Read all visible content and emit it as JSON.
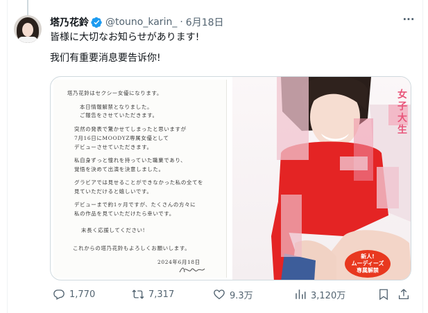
{
  "tweet": {
    "display_name": "塔乃花鈴",
    "handle": "@touno_karin_",
    "separator": "·",
    "date": "6月18日",
    "more_glyph": "···",
    "text_ja": "皆様に大切なお知らせがあります!",
    "text_zh": "我们有重要消息要告诉你!"
  },
  "media": {
    "letter_lines": [
      "塔乃花鈴はセクシー女優になります。",
      "本日情報解禁となりました。",
      "ご報告をさせていただきます。",
      "突然の発表で驚かせてしまったと思いますが",
      "7月16日にMOODYZ専属女優として",
      "デビューさせていただきます。",
      "私自身ずっと憧れを持っていた職業であり、",
      "覚悟を決めて出演を決意しました。",
      "グラビアでは見せることができなかった私の全てを",
      "見ていただけると嬉しいです。",
      "デビューまで約1ヶ月ですが、たくさんの方々に",
      "私の作品を見ていただけたら幸いです。",
      "末長く応援してください!",
      "これからの塔乃花鈴もよろしくお願いします。",
      "2024年6月18日"
    ],
    "photo_vertical_text": "女子大生",
    "badge_line1": "新人!",
    "badge_line2": "ムーディーズ",
    "badge_line3": "専属解禁"
  },
  "actions": {
    "replies": "1,770",
    "reposts": "7,317",
    "likes": "9.3万",
    "views": "3,120万"
  },
  "colors": {
    "verified": "#1d9bf0",
    "text": "#0f1419",
    "muted": "#536471",
    "border": "#cfd9de"
  },
  "icons": {
    "reply": "speech-bubble-icon",
    "repost": "repost-arrows-icon",
    "like": "heart-icon",
    "views": "bar-chart-icon",
    "bookmark": "bookmark-icon",
    "share": "share-icon",
    "verified": "verified-badge-icon",
    "more": "more-dots-icon"
  }
}
